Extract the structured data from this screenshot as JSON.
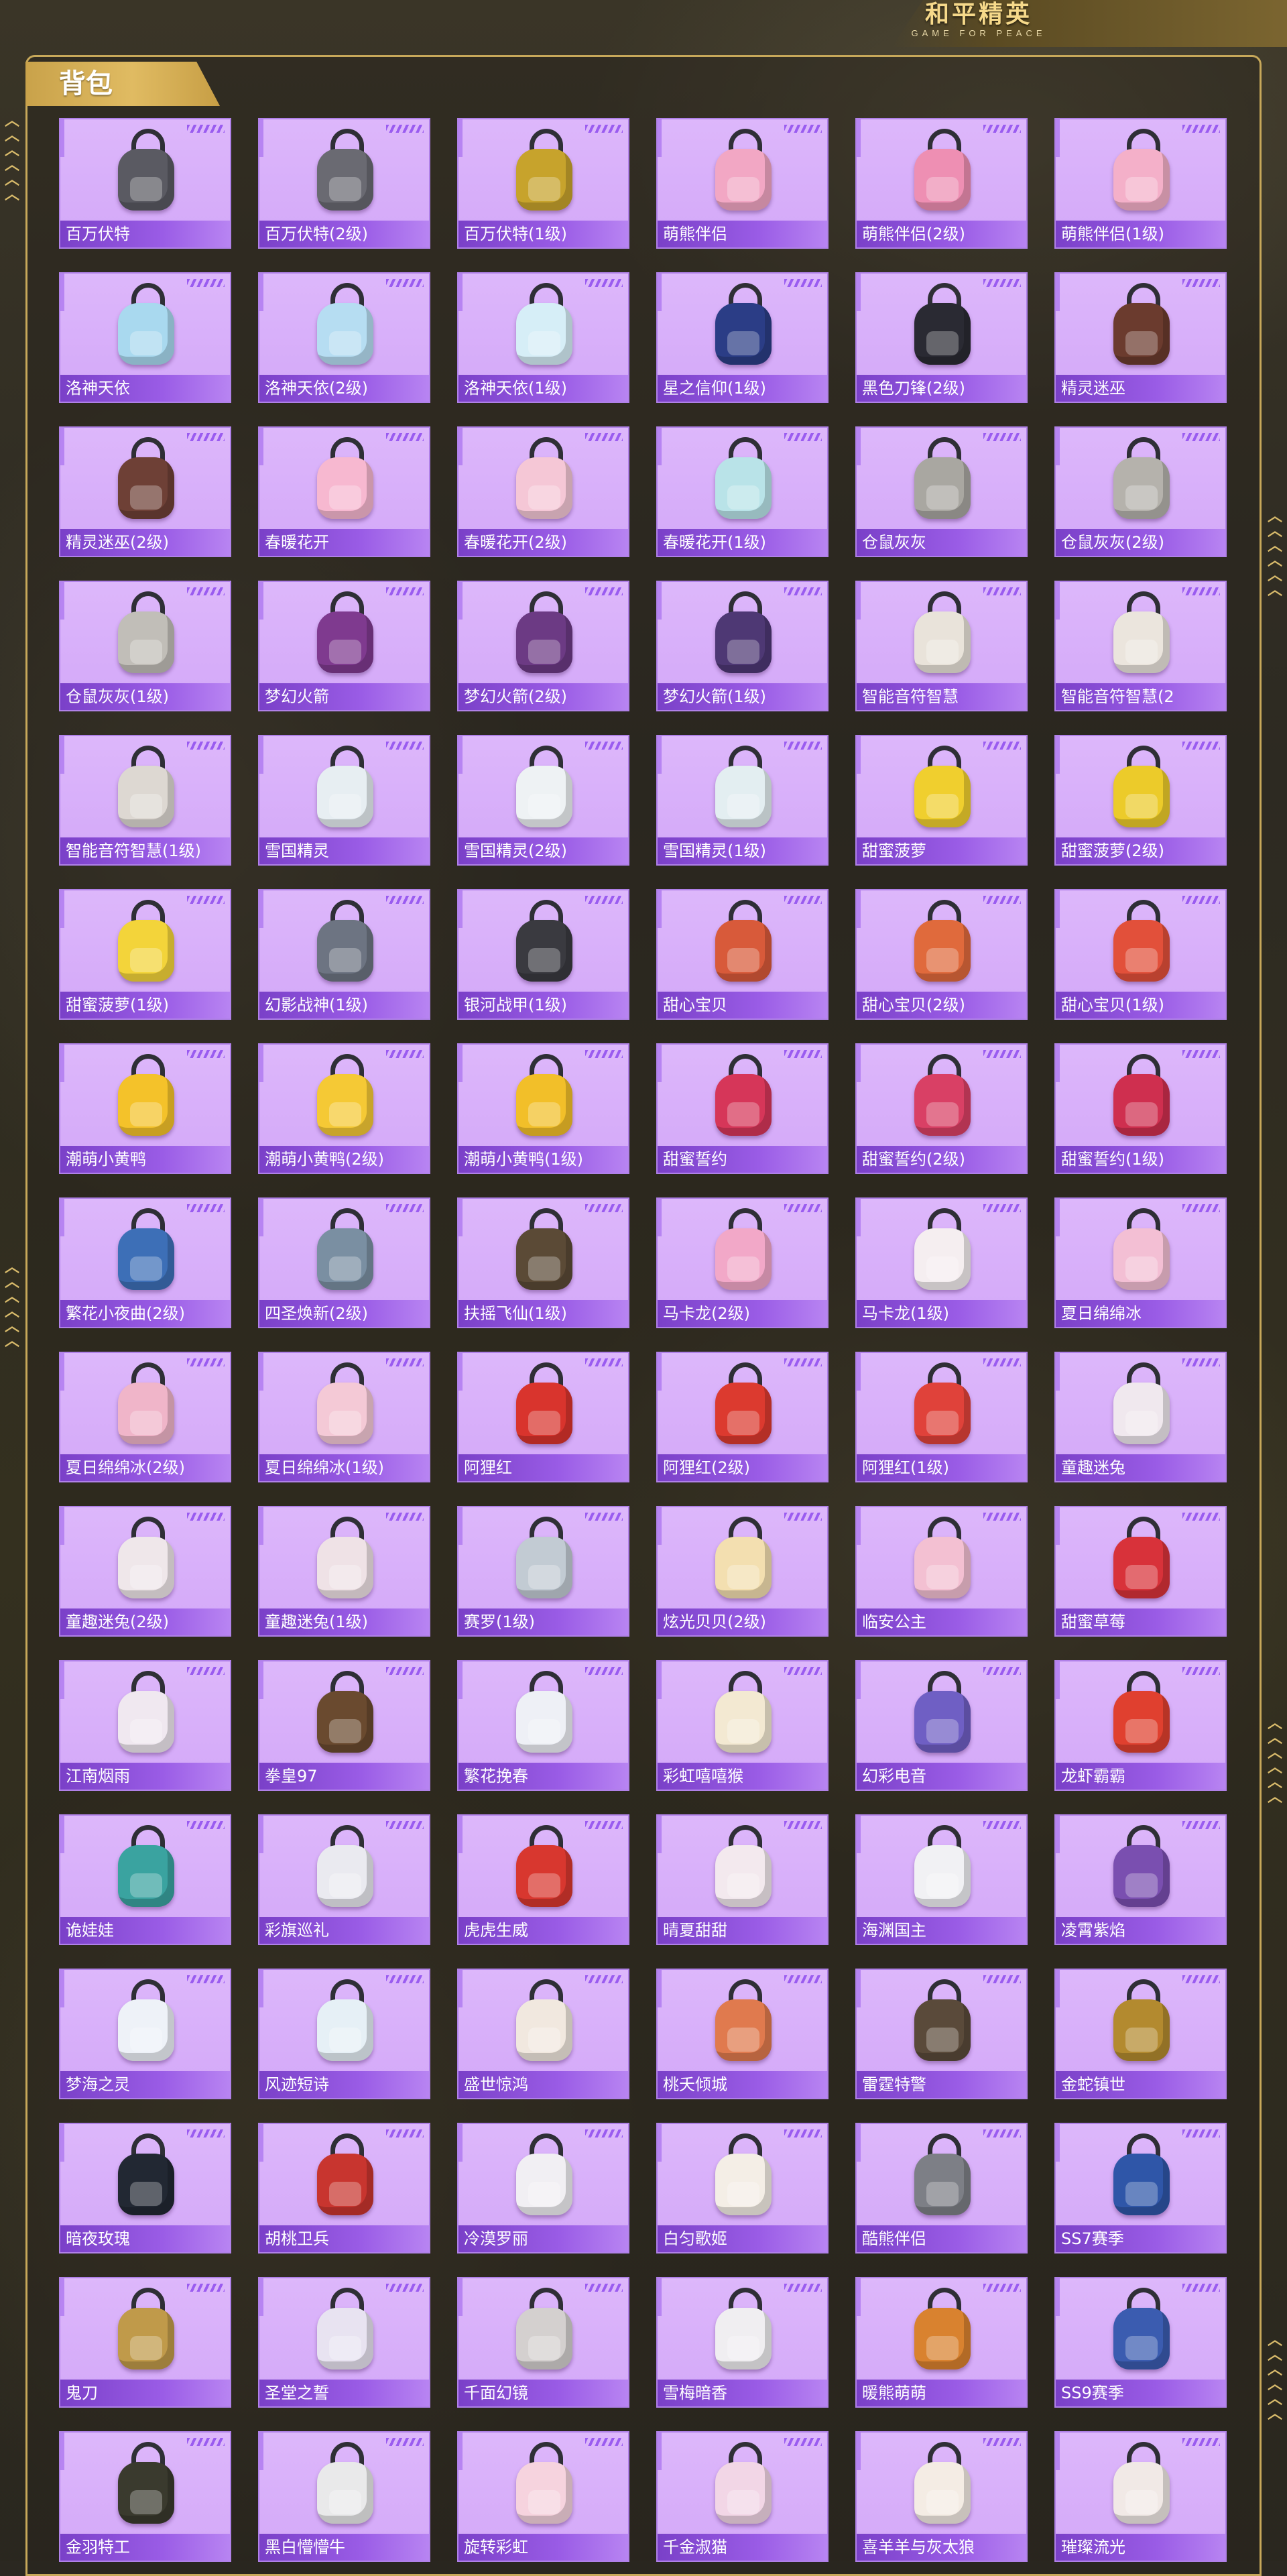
{
  "logo": {
    "main": "和平精英",
    "sub": "GAME FOR PEACE"
  },
  "header": {
    "title": "背包"
  },
  "colors": {
    "card_bg": "#d9b2fa",
    "label_bg": "#8d4fdc",
    "frame": "#c7a85a",
    "tab": "#d8b25a"
  },
  "items": [
    {
      "name": "百万伏特",
      "tone": "#5a5a62"
    },
    {
      "name": "百万伏特(2级)",
      "tone": "#6a6a72"
    },
    {
      "name": "百万伏特(1级)",
      "tone": "#c7a32c"
    },
    {
      "name": "萌熊伴侣",
      "tone": "#f2a7c4"
    },
    {
      "name": "萌熊伴侣(2级)",
      "tone": "#ee8fb3"
    },
    {
      "name": "萌熊伴侣(1级)",
      "tone": "#f4b0c9"
    },
    {
      "name": "洛神天依",
      "tone": "#a9d9ef"
    },
    {
      "name": "洛神天依(2级)",
      "tone": "#b6ddf2"
    },
    {
      "name": "洛神天依(1级)",
      "tone": "#d6eef7"
    },
    {
      "name": "星之信仰(1级)",
      "tone": "#2b3d86"
    },
    {
      "name": "黑色刀锋(2级)",
      "tone": "#2a2a33"
    },
    {
      "name": "精灵迷巫",
      "tone": "#6b3b2e"
    },
    {
      "name": "精灵迷巫(2级)",
      "tone": "#6e4036"
    },
    {
      "name": "春暖花开",
      "tone": "#f7b8d0"
    },
    {
      "name": "春暖花开(2级)",
      "tone": "#f5c7d6"
    },
    {
      "name": "春暖花开(1级)",
      "tone": "#b9e3e8"
    },
    {
      "name": "仓鼠灰灰",
      "tone": "#a9a7a1"
    },
    {
      "name": "仓鼠灰灰(2级)",
      "tone": "#b5b2ac"
    },
    {
      "name": "仓鼠灰灰(1级)",
      "tone": "#c1beb8"
    },
    {
      "name": "梦幻火箭",
      "tone": "#7f3a8f"
    },
    {
      "name": "梦幻火箭(2级)",
      "tone": "#6c3a84"
    },
    {
      "name": "梦幻火箭(1级)",
      "tone": "#4e3874"
    },
    {
      "name": "智能音符智慧",
      "tone": "#e9e3da"
    },
    {
      "name": "智能音符智慧(2",
      "tone": "#ebe5dd"
    },
    {
      "name": "智能音符智慧(1级)",
      "tone": "#ddd8d2"
    },
    {
      "name": "雪国精灵",
      "tone": "#e7eef2"
    },
    {
      "name": "雪国精灵(2级)",
      "tone": "#eef2f4"
    },
    {
      "name": "雪国精灵(1级)",
      "tone": "#e3eef1"
    },
    {
      "name": "甜蜜菠萝",
      "tone": "#f0cf2e"
    },
    {
      "name": "甜蜜菠萝(2级)",
      "tone": "#eccb2a"
    },
    {
      "name": "甜蜜菠萝(1级)",
      "tone": "#f3d43a"
    },
    {
      "name": "幻影战神(1级)",
      "tone": "#6d7482"
    },
    {
      "name": "银河战甲(1级)",
      "tone": "#3a3a40"
    },
    {
      "name": "甜心宝贝",
      "tone": "#d85a3a"
    },
    {
      "name": "甜心宝贝(2级)",
      "tone": "#e06a3c"
    },
    {
      "name": "甜心宝贝(1级)",
      "tone": "#e2503a"
    },
    {
      "name": "潮萌小黄鸭",
      "tone": "#f4c22a"
    },
    {
      "name": "潮萌小黄鸭(2级)",
      "tone": "#f5c935"
    },
    {
      "name": "潮萌小黄鸭(1级)",
      "tone": "#f2bf29"
    },
    {
      "name": "甜蜜誓约",
      "tone": "#d63659"
    },
    {
      "name": "甜蜜誓约(2级)",
      "tone": "#d94065"
    },
    {
      "name": "甜蜜誓约(1级)",
      "tone": "#cf2f4f"
    },
    {
      "name": "繁花小夜曲(2级)",
      "tone": "#3d6fb7"
    },
    {
      "name": "四圣焕新(2级)",
      "tone": "#7a8fa2"
    },
    {
      "name": "扶摇飞仙(1级)",
      "tone": "#5b4a36"
    },
    {
      "name": "马卡龙(2级)",
      "tone": "#f2a8c8"
    },
    {
      "name": "马卡龙(1级)",
      "tone": "#f5eef0"
    },
    {
      "name": "夏日绵绵冰",
      "tone": "#f3bfd4"
    },
    {
      "name": "夏日绵绵冰(2级)",
      "tone": "#f0b5c9"
    },
    {
      "name": "夏日绵绵冰(1级)",
      "tone": "#f4c9d6"
    },
    {
      "name": "阿狸红",
      "tone": "#d9342d"
    },
    {
      "name": "阿狸红(2级)",
      "tone": "#dc3a2f"
    },
    {
      "name": "阿狸红(1级)",
      "tone": "#e0423a"
    },
    {
      "name": "童趣迷兔",
      "tone": "#f0e8ee"
    },
    {
      "name": "童趣迷兔(2级)",
      "tone": "#efe7ea"
    },
    {
      "name": "童趣迷兔(1级)",
      "tone": "#efe2e6"
    },
    {
      "name": "赛罗(1级)",
      "tone": "#c2cbd3"
    },
    {
      "name": "炫光贝贝(2级)",
      "tone": "#f3dfb0"
    },
    {
      "name": "临安公主",
      "tone": "#f3c0d2"
    },
    {
      "name": "甜蜜草莓",
      "tone": "#d8323a"
    },
    {
      "name": "江南烟雨",
      "tone": "#f0e8f0"
    },
    {
      "name": "拳皇97",
      "tone": "#6a4a2f"
    },
    {
      "name": "繁花挽春",
      "tone": "#eef0f6"
    },
    {
      "name": "彩虹嘻嘻猴",
      "tone": "#f3e9d2"
    },
    {
      "name": "幻彩电音",
      "tone": "#6f5fc4"
    },
    {
      "name": "龙虾霸霸",
      "tone": "#e0402f"
    },
    {
      "name": "诡娃娃",
      "tone": "#3aa3a0"
    },
    {
      "name": "彩旗巡礼",
      "tone": "#eaeaf0"
    },
    {
      "name": "虎虎生威",
      "tone": "#d8372f"
    },
    {
      "name": "晴夏甜甜",
      "tone": "#f3e9ee"
    },
    {
      "name": "海渊国主",
      "tone": "#f1f1f4"
    },
    {
      "name": "凌霄紫焰",
      "tone": "#7a4fb0"
    },
    {
      "name": "梦海之灵",
      "tone": "#eef2f8"
    },
    {
      "name": "风迹短诗",
      "tone": "#e6f0f6"
    },
    {
      "name": "盛世惊鸿",
      "tone": "#f1e8df"
    },
    {
      "name": "桃夭倾城",
      "tone": "#e07a4e"
    },
    {
      "name": "雷霆特警",
      "tone": "#5a4a3a"
    },
    {
      "name": "金蛇镇世",
      "tone": "#b38a2f"
    },
    {
      "name": "暗夜玫瑰",
      "tone": "#222833"
    },
    {
      "name": "胡桃卫兵",
      "tone": "#c8352f"
    },
    {
      "name": "冷漠罗丽",
      "tone": "#f1eff3"
    },
    {
      "name": "白匀歌姬",
      "tone": "#f4eee6"
    },
    {
      "name": "酷熊伴侣",
      "tone": "#7d7f86"
    },
    {
      "name": "SS7赛季",
      "tone": "#2f56a8"
    },
    {
      "name": "鬼刀",
      "tone": "#c09a4a"
    },
    {
      "name": "圣堂之誓",
      "tone": "#e8e3f1"
    },
    {
      "name": "千面幻镜",
      "tone": "#d4d0cf"
    },
    {
      "name": "雪梅暗香",
      "tone": "#f0eef1"
    },
    {
      "name": "暖熊萌萌",
      "tone": "#d9822f"
    },
    {
      "name": "SS9赛季",
      "tone": "#3b5cb0"
    },
    {
      "name": "金羽特工",
      "tone": "#3a3a2e"
    },
    {
      "name": "黑白懵懵牛",
      "tone": "#e9e9ea"
    },
    {
      "name": "旋转彩虹",
      "tone": "#f6d3de"
    },
    {
      "name": "千金淑猫",
      "tone": "#f2d6e6"
    },
    {
      "name": "喜羊羊与灰太狼",
      "tone": "#f4ece4"
    },
    {
      "name": "璀璨流光",
      "tone": "#f1e9e6"
    }
  ]
}
